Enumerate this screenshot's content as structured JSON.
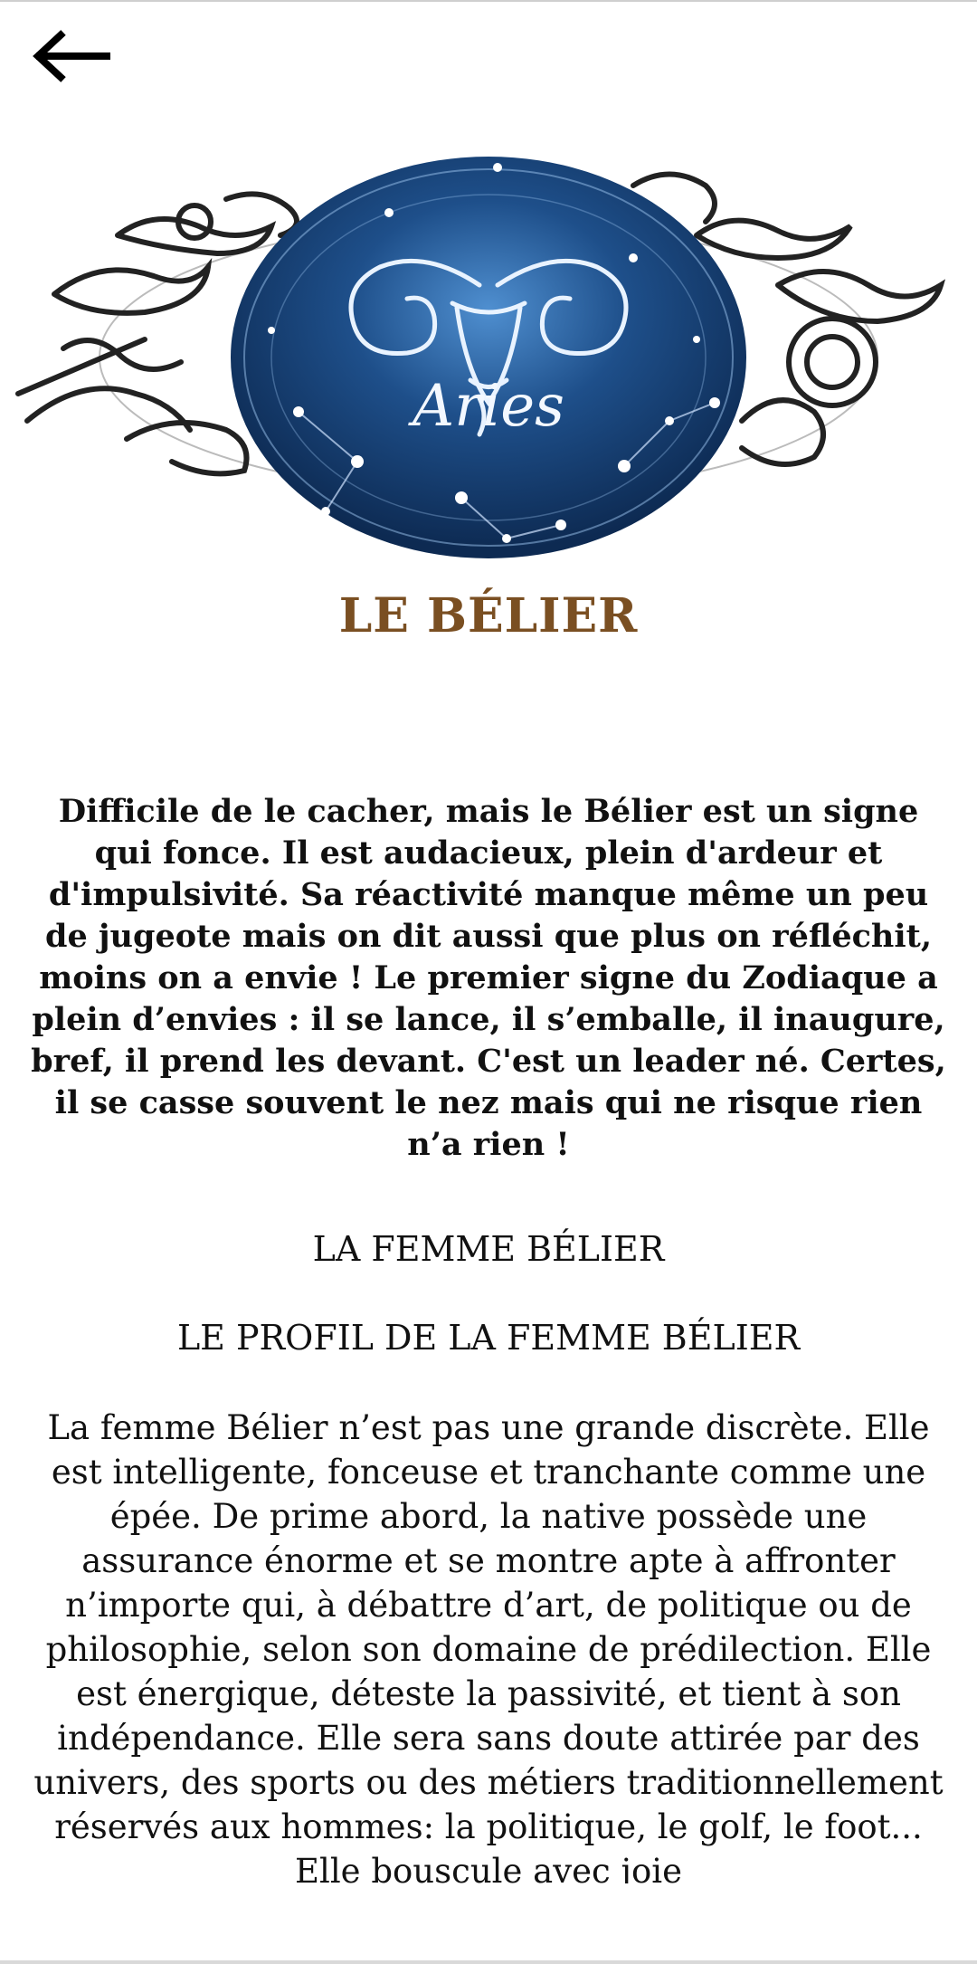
{
  "nav": {
    "back_icon": "arrow-left-icon"
  },
  "hero": {
    "sign_script": "Aries",
    "colors": {
      "disc_dark": "#0d2a52",
      "disc_light": "#4f8fd0"
    }
  },
  "title": "LE BÉLIER",
  "intro": "Difficile de le cacher, mais le Bélier est un signe qui fonce. Il est audacieux, plein d'ardeur et d'impulsivité. Sa réactivité manque même un peu de jugeote mais on dit aussi que plus on réfléchit, moins on a envie ! Le premier signe du Zodiaque a plein d’envies : il se lance, il s’emballe, il inaugure, bref, il prend les devant. C'est un leader né. Certes, il se casse souvent le nez mais qui ne risque rien n’a rien !",
  "section_title": "LA FEMME BÉLIER",
  "subsection_title": "LE PROFIL DE LA FEMME BÉLIER",
  "body": "La femme Bélier n’est pas une grande discrète. Elle est intelligente, fonceuse et tranchante comme une épée. De prime abord, la native possède une assurance énorme et se montre apte à affronter n’importe qui, à débattre d’art, de politique ou de philosophie, selon son domaine de prédilection. Elle est énergique, déteste la passivité, et tient à son indépendance. Elle sera sans doute attirée par des univers, des sports ou des métiers traditionnellement réservés aux hommes: la politique, le golf, le foot... Elle bouscule avec joie",
  "accent_color": "#7a4f22"
}
